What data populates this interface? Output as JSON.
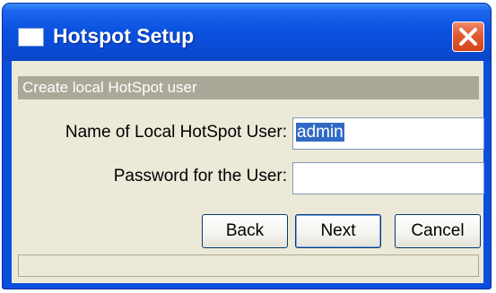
{
  "window": {
    "title": "Hotspot Setup",
    "icon": "window-icon",
    "close_icon": "close-icon"
  },
  "section": {
    "header": "Create local HotSpot user"
  },
  "form": {
    "username_label": "Name of Local HotSpot User:",
    "username_value": "admin",
    "password_label": "Password for the User:",
    "password_value": ""
  },
  "buttons": {
    "back": "Back",
    "next": "Next",
    "cancel": "Cancel"
  },
  "status": "",
  "colors": {
    "titlebar": "#0a4ede",
    "close": "#e05a32",
    "client": "#ece9d8",
    "section_header": "#aca899",
    "selection": "#316ac5"
  }
}
